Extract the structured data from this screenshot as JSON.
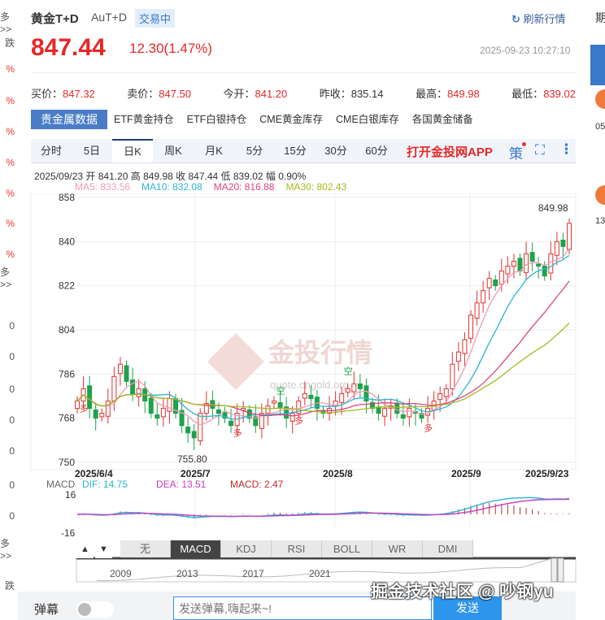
{
  "left_strip": {
    "items": [
      "多>>",
      "跌",
      "%",
      "%",
      "%",
      "%",
      "%",
      "%",
      "%",
      "多>>",
      "0",
      "0",
      "0",
      "0",
      "0",
      "0",
      "0",
      "多>>",
      "跌"
    ]
  },
  "right_strip": {
    "items": [
      "期",
      "05",
      "13"
    ]
  },
  "header": {
    "name": "黄金T+D",
    "code": "AuT+D",
    "status": "交易中",
    "refresh": "刷新行情"
  },
  "price": {
    "last": "847.44",
    "change": "12.30(1.47%)",
    "time": "2025-09-23 10:27:10"
  },
  "quote": [
    {
      "label": "买价：",
      "value": "847.32",
      "red": true
    },
    {
      "label": "卖价：",
      "value": "847.50",
      "red": true
    },
    {
      "label": "今开：",
      "value": "841.20",
      "red": true
    },
    {
      "label": "昨收：",
      "value": "835.14",
      "red": false
    },
    {
      "label": "最高：",
      "value": "849.98",
      "red": true
    },
    {
      "label": "最低：",
      "value": "839.02",
      "red": true
    }
  ],
  "data_tabs": [
    "贵金属数据",
    "ETF黄金持仓",
    "ETF白银持仓",
    "CME黄金库存",
    "CME白银库存",
    "各国黄金储备"
  ],
  "period_tabs": [
    "分时",
    "5日",
    "日K",
    "周K",
    "月K",
    "5分",
    "15分",
    "30分",
    "60分"
  ],
  "active_period": "日K",
  "app_link": "打开金投网APP",
  "strategy": "策",
  "info_line": "2025/09/23 开 841.20 高 849.98 收 847.44 低 839.02 幅 0.90%",
  "ma": [
    {
      "label": "MA5: 833.56",
      "color": "#f09ab8"
    },
    {
      "label": "MA10: 832.08",
      "color": "#2ab6d0"
    },
    {
      "label": "MA20: 816.88",
      "color": "#e0447a"
    },
    {
      "label": "MA30: 802.43",
      "color": "#a8b820"
    }
  ],
  "watermark": "金投行情",
  "watermark_url": "quote.cngold.org",
  "chart_data": {
    "type": "candlestick",
    "ylim": [
      750,
      858
    ],
    "yticks": [
      "858",
      "840",
      "822",
      "804",
      "786",
      "768",
      "750"
    ],
    "xticks": [
      "2025/6/4",
      "2025/7",
      "2025/8",
      "2025/9",
      "2025/9/23"
    ],
    "max_label": "849.98",
    "min_label": "755.80",
    "closes": [
      775,
      780,
      772,
      768,
      770,
      775,
      785,
      790,
      783,
      778,
      780,
      775,
      770,
      768,
      772,
      776,
      770,
      765,
      762,
      760,
      770,
      774,
      772,
      770,
      768,
      765,
      770,
      772,
      768,
      765,
      770,
      773,
      775,
      772,
      768,
      770,
      775,
      778,
      776,
      772,
      770,
      772,
      775,
      778,
      780,
      782,
      780,
      775,
      772,
      770,
      772,
      773,
      770,
      768,
      772,
      770,
      768,
      772,
      775,
      778,
      780,
      790,
      795,
      800,
      810,
      815,
      820,
      825,
      822,
      828,
      830,
      832,
      828,
      835,
      832,
      830,
      826,
      835,
      840,
      838,
      847.44
    ],
    "signals": [
      {
        "text": "多",
        "i": 1
      },
      {
        "text": "多",
        "i": 26
      },
      {
        "text": "空",
        "i": 33
      },
      {
        "text": "多",
        "i": 36
      },
      {
        "text": "空",
        "i": 44
      },
      {
        "text": "多",
        "i": 57
      }
    ]
  },
  "macd": {
    "title": "MACD",
    "dif": "DIF: 14.75",
    "dea": "DEA: 13.51",
    "macd": "MACD: 2.47",
    "yticks": [
      "16",
      "-16"
    ]
  },
  "indicator_tabs": [
    "无",
    "MACD",
    "KDJ",
    "RSI",
    "BOLL",
    "WR",
    "DMI"
  ],
  "active_indicator": "MACD",
  "overview_years": [
    "2009",
    "2013",
    "2017",
    "2021"
  ],
  "danmaku": {
    "label": "弹幕",
    "placeholder": "发送弹幕,嗨起来~!",
    "send": "发送"
  },
  "credit": "掘金技术社区 @ 吵钢yu"
}
